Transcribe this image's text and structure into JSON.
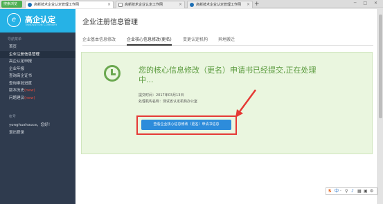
{
  "browser": {
    "home_label": "搜索浏览",
    "tabs": [
      {
        "label": "高新技术企业认定管理工作网",
        "active": true
      },
      {
        "label": "高新技术企业认定工作网",
        "active": false
      },
      {
        "label": "高新技术企业认定管理工作网",
        "active": false
      }
    ],
    "new_tab": "+",
    "window_controls": "─ □ ✕"
  },
  "sidebar": {
    "logo_mark": "e",
    "logo_title": "高企认定",
    "logo_subtitle": "INNOVATION COMPANY",
    "section_label": "导航菜单",
    "items": [
      {
        "label": "首页",
        "active": false,
        "badge": ""
      },
      {
        "label": "企业注册信息管理",
        "active": true,
        "badge": ""
      },
      {
        "label": "高企认定申报",
        "active": false,
        "badge": ""
      },
      {
        "label": "企业年报",
        "active": false,
        "badge": ""
      },
      {
        "label": "查询高企证书",
        "active": false,
        "badge": ""
      },
      {
        "label": "查询审批进度",
        "active": false,
        "badge": ""
      },
      {
        "label": "版本历史",
        "active": false,
        "badge": "(new)"
      },
      {
        "label": "问题建议",
        "active": false,
        "badge": "(new)"
      }
    ],
    "account_label": "帐号",
    "account_items": [
      {
        "label": "yonghushouce，您好！"
      },
      {
        "label": "退出登录"
      }
    ]
  },
  "main": {
    "title": "企业注册信息管理",
    "tabs": [
      {
        "label": "企业基本信息修改",
        "active": false
      },
      {
        "label": "企业核心信息修改(更名)",
        "active": true
      },
      {
        "label": "变更认定机构",
        "active": false
      },
      {
        "label": "异地搬迁",
        "active": false
      }
    ],
    "notice": {
      "message": "您的核心信息修改（更名）申请书已经提交,正在处理中...",
      "submit_time": "提交时间：2017年03月13日",
      "agency": "处理机构名称：测试省认定机构办公室",
      "button_label": "查看企业核心信息修改（更名）申请书信息"
    }
  },
  "tray": [
    "S",
    "中",
    "·",
    "⚲",
    "♪",
    "▦",
    "▣",
    "⚙"
  ],
  "colors": {
    "sidebar_bg": "#2f3b4e",
    "logo_bg": "#26b2e6",
    "panel_bg": "#eaf6df",
    "success_green": "#5a9a3d",
    "button_blue": "#2d8cdb",
    "annotation_red": "#e53935",
    "badge_red": "#e74c3c"
  }
}
